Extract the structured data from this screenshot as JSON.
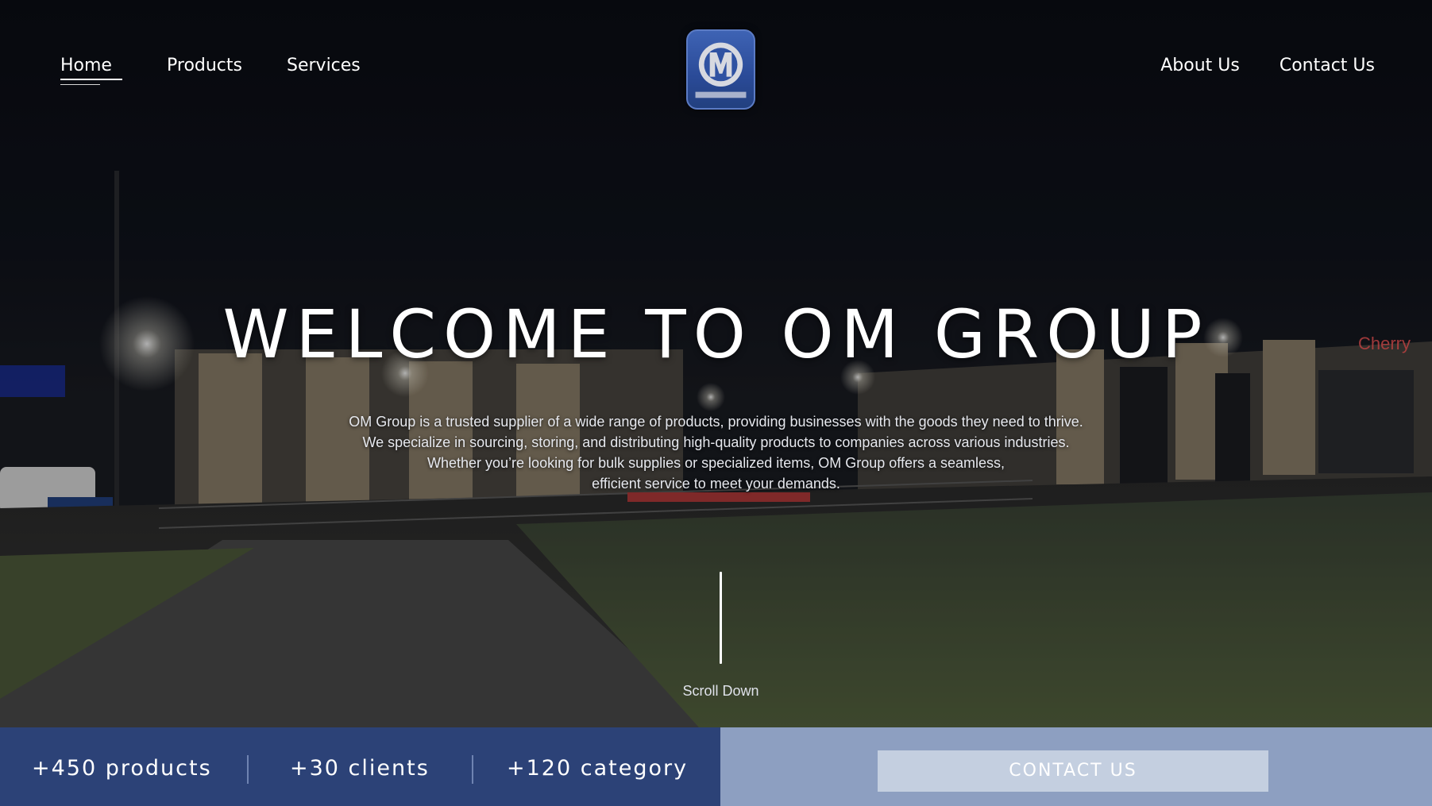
{
  "header": {
    "nav_left": [
      {
        "label": "Home",
        "active": true
      },
      {
        "label": "Products",
        "active": false
      },
      {
        "label": "Services",
        "active": false
      }
    ],
    "nav_right": [
      {
        "label": "About Us"
      },
      {
        "label": "Contact Us"
      }
    ],
    "logo": {
      "letter": "M",
      "icon": "om-group-logo-icon"
    }
  },
  "hero": {
    "title": "WELCOME TO OM GROUP",
    "description_lines": [
      "OM Group is a trusted supplier of a wide range of products, providing businesses with the goods they need to thrive.",
      "We specialize in sourcing, storing, and distributing high-quality products to companies across various industries.",
      "Whether you’re looking for bulk supplies or specialized items, OM Group offers a seamless,",
      "efficient service to meet your demands."
    ],
    "scroll_label": "Scroll Down"
  },
  "stats": [
    {
      "label": "+450 products"
    },
    {
      "label": "+30 clients"
    },
    {
      "label": "+120 category"
    }
  ],
  "cta": {
    "label": "CONTACT US"
  },
  "colors": {
    "stats_bar": "#2c4277",
    "cta_panel": "#8d9fc1",
    "cta_button": "#c4cfe0",
    "logo_blue": "#2a4a97"
  }
}
